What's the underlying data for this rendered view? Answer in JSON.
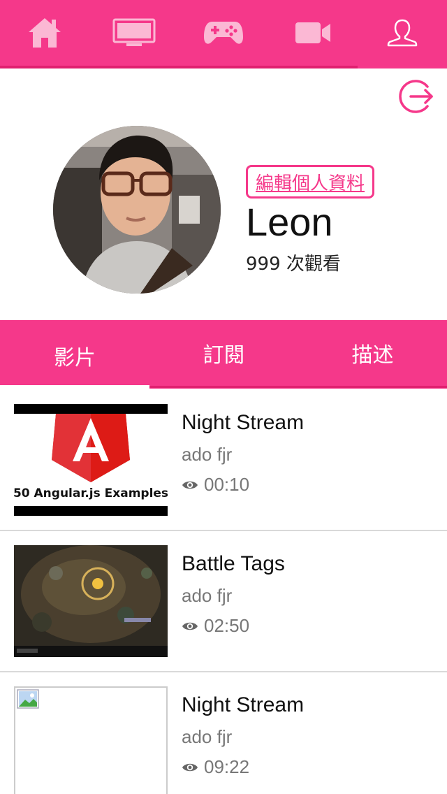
{
  "nav": {
    "items": [
      {
        "icon": "home-icon"
      },
      {
        "icon": "tv-icon"
      },
      {
        "icon": "gamepad-icon"
      },
      {
        "icon": "video-camera-icon"
      },
      {
        "icon": "user-icon",
        "active": true
      }
    ]
  },
  "profile": {
    "edit_label": "編輯個人資料",
    "name": "Leon",
    "views": "999 次觀看"
  },
  "tabs": [
    {
      "label": "影片",
      "active": true
    },
    {
      "label": "訂閱"
    },
    {
      "label": "描述"
    }
  ],
  "videos": [
    {
      "title": "Night Stream",
      "author": "ado fjr",
      "duration": "00:10",
      "thumb_caption": "50 Angular.js Examples"
    },
    {
      "title": "Battle Tags",
      "author": "ado fjr",
      "duration": "02:50"
    },
    {
      "title": "Night Stream",
      "author": "ado fjr",
      "duration": "09:22"
    }
  ],
  "colors": {
    "accent": "#f5388a",
    "accent_dark": "#e0206f",
    "text_muted": "#777777"
  }
}
